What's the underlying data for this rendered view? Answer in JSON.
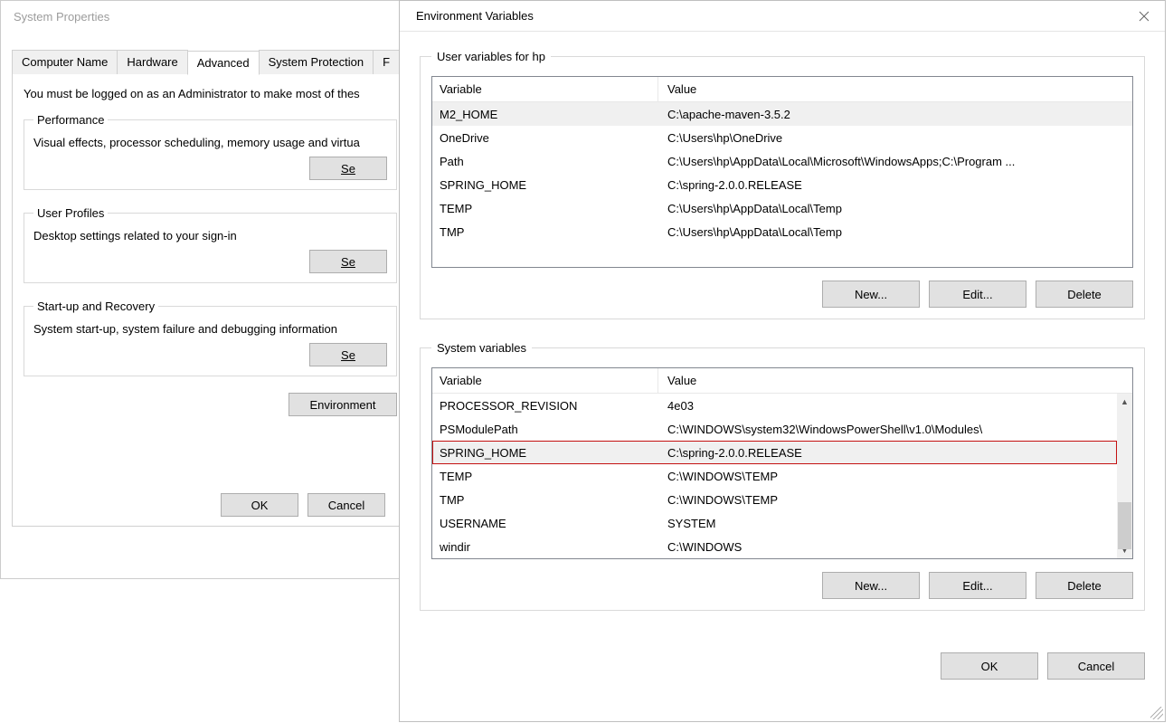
{
  "sysprop": {
    "title": "System Properties",
    "tabs": [
      "Computer Name",
      "Hardware",
      "Advanced",
      "System Protection",
      "F"
    ],
    "active_tab_index": 2,
    "intro": "You must be logged on as an Administrator to make most of thes",
    "sections": [
      {
        "legend": "Performance",
        "desc": "Visual effects, processor scheduling, memory usage and virtua",
        "button": "Se"
      },
      {
        "legend": "User Profiles",
        "desc": "Desktop settings related to your sign-in",
        "button": "Se"
      },
      {
        "legend": "Start-up and Recovery",
        "desc": "System start-up, system failure and debugging information",
        "button": "Se"
      }
    ],
    "env_button": "Environment",
    "footer": {
      "ok": "OK",
      "cancel": "Cancel"
    }
  },
  "envwin": {
    "title": "Environment Variables",
    "user_group_label": "User variables for hp",
    "system_group_label": "System variables",
    "headers": {
      "variable": "Variable",
      "value": "Value"
    },
    "user_vars": [
      {
        "name": "M2_HOME",
        "value": "C:\\apache-maven-3.5.2",
        "selected": true
      },
      {
        "name": "OneDrive",
        "value": "C:\\Users\\hp\\OneDrive"
      },
      {
        "name": "Path",
        "value": "C:\\Users\\hp\\AppData\\Local\\Microsoft\\WindowsApps;C:\\Program ..."
      },
      {
        "name": "SPRING_HOME",
        "value": "C:\\spring-2.0.0.RELEASE"
      },
      {
        "name": "TEMP",
        "value": "C:\\Users\\hp\\AppData\\Local\\Temp"
      },
      {
        "name": "TMP",
        "value": "C:\\Users\\hp\\AppData\\Local\\Temp"
      }
    ],
    "system_vars": [
      {
        "name": "PROCESSOR_REVISION",
        "value": "4e03"
      },
      {
        "name": "PSModulePath",
        "value": "C:\\WINDOWS\\system32\\WindowsPowerShell\\v1.0\\Modules\\"
      },
      {
        "name": "SPRING_HOME",
        "value": "C:\\spring-2.0.0.RELEASE",
        "selected": true,
        "highlighted": true
      },
      {
        "name": "TEMP",
        "value": "C:\\WINDOWS\\TEMP"
      },
      {
        "name": "TMP",
        "value": "C:\\WINDOWS\\TEMP"
      },
      {
        "name": "USERNAME",
        "value": "SYSTEM"
      },
      {
        "name": "windir",
        "value": "C:\\WINDOWS"
      }
    ],
    "buttons": {
      "new": "New...",
      "edit": "Edit...",
      "delete": "Delete",
      "ok": "OK",
      "cancel": "Cancel"
    }
  }
}
